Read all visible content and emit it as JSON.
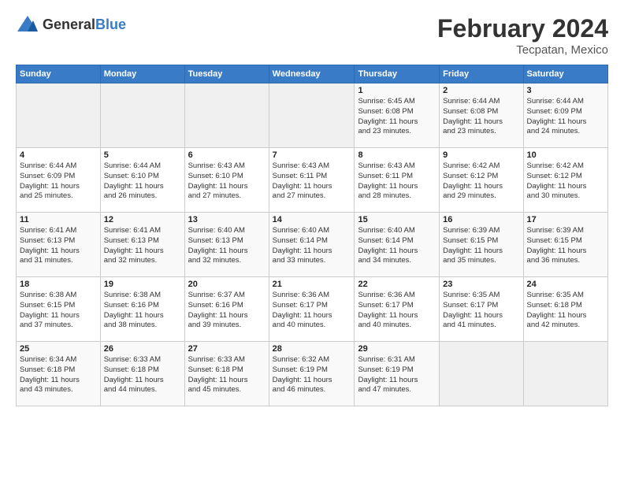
{
  "header": {
    "logo_general": "General",
    "logo_blue": "Blue",
    "title": "February 2024",
    "location": "Tecpatan, Mexico"
  },
  "days_of_week": [
    "Sunday",
    "Monday",
    "Tuesday",
    "Wednesday",
    "Thursday",
    "Friday",
    "Saturday"
  ],
  "weeks": [
    [
      {
        "day": "",
        "info": ""
      },
      {
        "day": "",
        "info": ""
      },
      {
        "day": "",
        "info": ""
      },
      {
        "day": "",
        "info": ""
      },
      {
        "day": "1",
        "info": "Sunrise: 6:45 AM\nSunset: 6:08 PM\nDaylight: 11 hours\nand 23 minutes."
      },
      {
        "day": "2",
        "info": "Sunrise: 6:44 AM\nSunset: 6:08 PM\nDaylight: 11 hours\nand 23 minutes."
      },
      {
        "day": "3",
        "info": "Sunrise: 6:44 AM\nSunset: 6:09 PM\nDaylight: 11 hours\nand 24 minutes."
      }
    ],
    [
      {
        "day": "4",
        "info": "Sunrise: 6:44 AM\nSunset: 6:09 PM\nDaylight: 11 hours\nand 25 minutes."
      },
      {
        "day": "5",
        "info": "Sunrise: 6:44 AM\nSunset: 6:10 PM\nDaylight: 11 hours\nand 26 minutes."
      },
      {
        "day": "6",
        "info": "Sunrise: 6:43 AM\nSunset: 6:10 PM\nDaylight: 11 hours\nand 27 minutes."
      },
      {
        "day": "7",
        "info": "Sunrise: 6:43 AM\nSunset: 6:11 PM\nDaylight: 11 hours\nand 27 minutes."
      },
      {
        "day": "8",
        "info": "Sunrise: 6:43 AM\nSunset: 6:11 PM\nDaylight: 11 hours\nand 28 minutes."
      },
      {
        "day": "9",
        "info": "Sunrise: 6:42 AM\nSunset: 6:12 PM\nDaylight: 11 hours\nand 29 minutes."
      },
      {
        "day": "10",
        "info": "Sunrise: 6:42 AM\nSunset: 6:12 PM\nDaylight: 11 hours\nand 30 minutes."
      }
    ],
    [
      {
        "day": "11",
        "info": "Sunrise: 6:41 AM\nSunset: 6:13 PM\nDaylight: 11 hours\nand 31 minutes."
      },
      {
        "day": "12",
        "info": "Sunrise: 6:41 AM\nSunset: 6:13 PM\nDaylight: 11 hours\nand 32 minutes."
      },
      {
        "day": "13",
        "info": "Sunrise: 6:40 AM\nSunset: 6:13 PM\nDaylight: 11 hours\nand 32 minutes."
      },
      {
        "day": "14",
        "info": "Sunrise: 6:40 AM\nSunset: 6:14 PM\nDaylight: 11 hours\nand 33 minutes."
      },
      {
        "day": "15",
        "info": "Sunrise: 6:40 AM\nSunset: 6:14 PM\nDaylight: 11 hours\nand 34 minutes."
      },
      {
        "day": "16",
        "info": "Sunrise: 6:39 AM\nSunset: 6:15 PM\nDaylight: 11 hours\nand 35 minutes."
      },
      {
        "day": "17",
        "info": "Sunrise: 6:39 AM\nSunset: 6:15 PM\nDaylight: 11 hours\nand 36 minutes."
      }
    ],
    [
      {
        "day": "18",
        "info": "Sunrise: 6:38 AM\nSunset: 6:15 PM\nDaylight: 11 hours\nand 37 minutes."
      },
      {
        "day": "19",
        "info": "Sunrise: 6:38 AM\nSunset: 6:16 PM\nDaylight: 11 hours\nand 38 minutes."
      },
      {
        "day": "20",
        "info": "Sunrise: 6:37 AM\nSunset: 6:16 PM\nDaylight: 11 hours\nand 39 minutes."
      },
      {
        "day": "21",
        "info": "Sunrise: 6:36 AM\nSunset: 6:17 PM\nDaylight: 11 hours\nand 40 minutes."
      },
      {
        "day": "22",
        "info": "Sunrise: 6:36 AM\nSunset: 6:17 PM\nDaylight: 11 hours\nand 40 minutes."
      },
      {
        "day": "23",
        "info": "Sunrise: 6:35 AM\nSunset: 6:17 PM\nDaylight: 11 hours\nand 41 minutes."
      },
      {
        "day": "24",
        "info": "Sunrise: 6:35 AM\nSunset: 6:18 PM\nDaylight: 11 hours\nand 42 minutes."
      }
    ],
    [
      {
        "day": "25",
        "info": "Sunrise: 6:34 AM\nSunset: 6:18 PM\nDaylight: 11 hours\nand 43 minutes."
      },
      {
        "day": "26",
        "info": "Sunrise: 6:33 AM\nSunset: 6:18 PM\nDaylight: 11 hours\nand 44 minutes."
      },
      {
        "day": "27",
        "info": "Sunrise: 6:33 AM\nSunset: 6:18 PM\nDaylight: 11 hours\nand 45 minutes."
      },
      {
        "day": "28",
        "info": "Sunrise: 6:32 AM\nSunset: 6:19 PM\nDaylight: 11 hours\nand 46 minutes."
      },
      {
        "day": "29",
        "info": "Sunrise: 6:31 AM\nSunset: 6:19 PM\nDaylight: 11 hours\nand 47 minutes."
      },
      {
        "day": "",
        "info": ""
      },
      {
        "day": "",
        "info": ""
      }
    ]
  ]
}
